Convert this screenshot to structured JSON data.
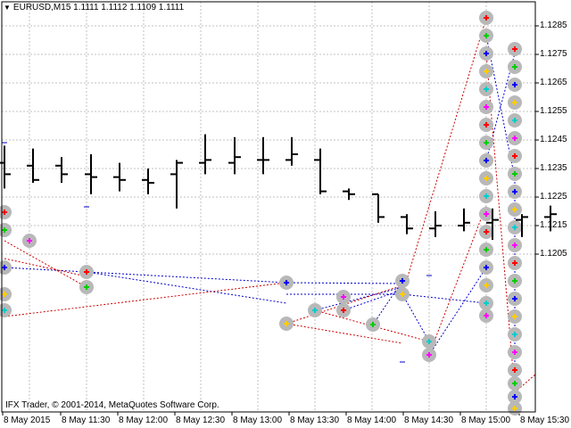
{
  "header": {
    "symbol_label": "EURUSD,M15",
    "prices": "1.1111 1.1112 1.1109 1.1111"
  },
  "footer": {
    "copyright": "IFX Trader, © 2001-2014, MetaQuotes Software Corp."
  },
  "axes": {
    "y_ticks": [
      "1.1285",
      "1.1275",
      "1.1265",
      "1.1255",
      "1.1245",
      "1.1235",
      "1.1225",
      "1.1215",
      "1.1205"
    ],
    "x_ticks": [
      "8 May 2015",
      "8 May 11:30",
      "8 May 12:00",
      "8 May 12:30",
      "8 May 13:00",
      "8 May 13:30",
      "8 May 14:00",
      "8 May 14:30",
      "8 May 15:00",
      "8 May 15:30"
    ]
  },
  "colors": {
    "background": "#ffffff",
    "grid": "#c0c0c0",
    "bars": "#000000",
    "blue_lines": "#0000cc",
    "red_lines": "#cc0000",
    "marker_halo": "#b8b8b8"
  },
  "chart_data": {
    "type": "ohlc",
    "bars": [
      {
        "o": 1.1237,
        "h": 1.1243,
        "l": 1.1228,
        "c": 1.1233
      },
      {
        "o": 1.1236,
        "h": 1.1242,
        "l": 1.123,
        "c": 1.1231
      },
      {
        "o": 1.1236,
        "h": 1.1239,
        "l": 1.123,
        "c": 1.1233
      },
      {
        "o": 1.1233,
        "h": 1.124,
        "l": 1.1226,
        "c": 1.1232
      },
      {
        "o": 1.1232,
        "h": 1.1237,
        "l": 1.1227,
        "c": 1.1231
      },
      {
        "o": 1.1231,
        "h": 1.1235,
        "l": 1.1226,
        "c": 1.123
      },
      {
        "o": 1.1233,
        "h": 1.1238,
        "l": 1.1221,
        "c": 1.1237
      },
      {
        "o": 1.1237,
        "h": 1.1247,
        "l": 1.1233,
        "c": 1.1238
      },
      {
        "o": 1.1237,
        "h": 1.1246,
        "l": 1.1233,
        "c": 1.1239
      },
      {
        "o": 1.1238,
        "h": 1.1246,
        "l": 1.1233,
        "c": 1.1238
      },
      {
        "o": 1.1238,
        "h": 1.1246,
        "l": 1.1236,
        "c": 1.124
      },
      {
        "o": 1.1238,
        "h": 1.1242,
        "l": 1.1226,
        "c": 1.1227
      },
      {
        "o": 1.1227,
        "h": 1.1228,
        "l": 1.1224,
        "c": 1.1226
      },
      {
        "o": 1.1226,
        "h": 1.1226,
        "l": 1.1216,
        "c": 1.1218
      },
      {
        "o": 1.1218,
        "h": 1.1219,
        "l": 1.1212,
        "c": 1.1214
      },
      {
        "o": 1.1214,
        "h": 1.122,
        "l": 1.1211,
        "c": 1.1215
      },
      {
        "o": 1.1215,
        "h": 1.1221,
        "l": 1.1213,
        "c": 1.1216
      },
      {
        "o": 1.1216,
        "h": 1.1221,
        "l": 1.121,
        "c": 1.1217
      },
      {
        "o": 1.1217,
        "h": 1.1219,
        "l": 1.1211,
        "c": 1.1218
      },
      {
        "o": 1.1218,
        "h": 1.1222,
        "l": 1.1213,
        "c": 1.1219
      },
      {
        "o": 1.1219,
        "h": 1.1224,
        "l": 1.1212,
        "c": 1.1218
      },
      {
        "o": 1.1218,
        "h": 1.1221,
        "l": 1.1208,
        "c": 1.1209
      },
      {
        "o": 1.1209,
        "h": 1.1222,
        "l": 1.1209,
        "c": 1.1221
      },
      {
        "o": 1.1221,
        "h": 1.1221,
        "l": 1.1221,
        "c": 1.1221
      },
      {
        "o": 1.1221,
        "h": 1.1284,
        "l": 1.1221,
        "c": 1.1272
      },
      {
        "o": 1.127,
        "h": 1.128,
        "l": 1.1201,
        "c": 1.121
      }
    ]
  }
}
